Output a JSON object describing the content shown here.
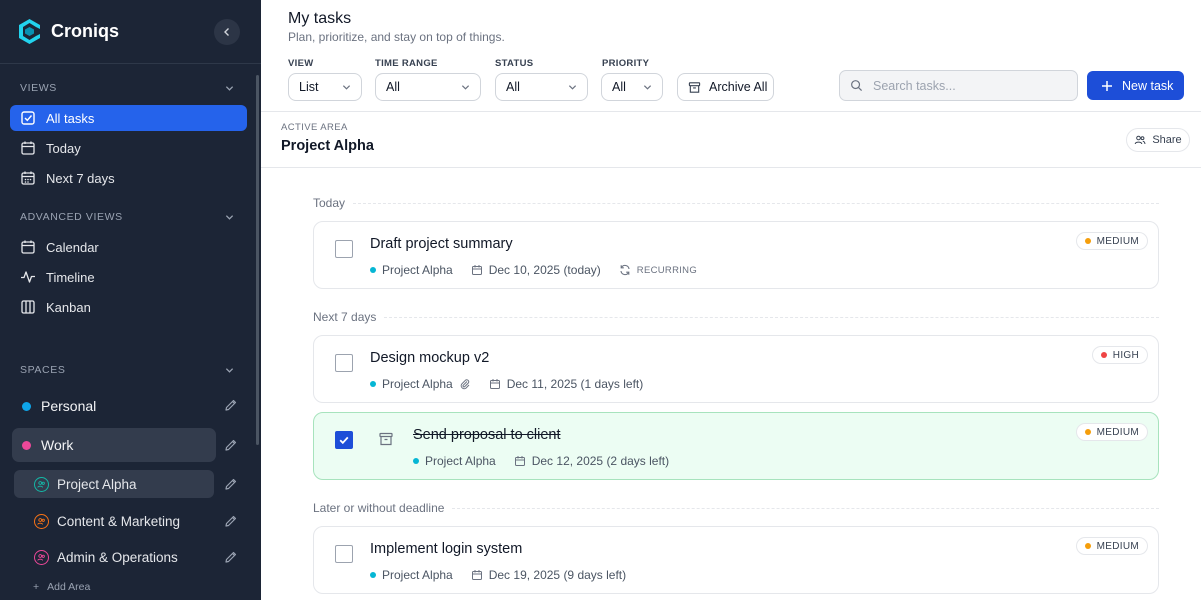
{
  "app": {
    "name": "Croniqs"
  },
  "sidebar": {
    "views_heading": "VIEWS",
    "views": [
      {
        "label": "All tasks",
        "icon": "check-square-icon",
        "active": true
      },
      {
        "label": "Today",
        "icon": "calendar-icon",
        "active": false
      },
      {
        "label": "Next 7 days",
        "icon": "calendar-week-icon",
        "active": false
      }
    ],
    "advanced_heading": "ADVANCED VIEWS",
    "advanced": [
      {
        "label": "Calendar",
        "icon": "calendar-icon"
      },
      {
        "label": "Timeline",
        "icon": "activity-icon"
      },
      {
        "label": "Kanban",
        "icon": "columns-icon"
      }
    ],
    "spaces_heading": "SPACES",
    "spaces": [
      {
        "label": "Personal",
        "color": "#0ea5e9"
      },
      {
        "label": "Work",
        "color": "#ec4899"
      }
    ],
    "areas": [
      {
        "label": "Project Alpha",
        "color": "#14b8a6"
      },
      {
        "label": "Content & Marketing",
        "color": "#f97316"
      },
      {
        "label": "Admin & Operations",
        "color": "#ec4899"
      }
    ],
    "add_area": "Add Area"
  },
  "header": {
    "title": "My tasks",
    "subtitle": "Plan, prioritize, and stay on top of things.",
    "filters": {
      "view_label": "VIEW",
      "view_value": "List",
      "range_label": "TIME RANGE",
      "range_value": "All",
      "status_label": "STATUS",
      "status_value": "All",
      "priority_label": "PRIORITY",
      "priority_value": "All"
    },
    "archive_all": "Archive All",
    "search_placeholder": "Search tasks...",
    "new_task": "New task"
  },
  "area": {
    "label": "ACTIVE AREA",
    "name": "Project Alpha",
    "share": "Share"
  },
  "groups": [
    {
      "heading": "Today"
    },
    {
      "heading": "Next 7 days"
    },
    {
      "heading": "Later or without deadline"
    }
  ],
  "tasks": [
    {
      "title": "Draft project summary",
      "project": "Project Alpha",
      "date": "Dec 10, 2025 (today)",
      "recurring": "RECURRING",
      "priority": "MEDIUM",
      "priority_color": "#f59e0b",
      "done": false
    },
    {
      "title": "Design mockup v2",
      "project": "Project Alpha",
      "date": "Dec 11, 2025 (1 days left)",
      "priority": "HIGH",
      "priority_color": "#ef4444",
      "done": false,
      "attachment": true
    },
    {
      "title": "Send proposal to client",
      "project": "Project Alpha",
      "date": "Dec 12, 2025 (2 days left)",
      "priority": "MEDIUM",
      "priority_color": "#f59e0b",
      "done": true
    },
    {
      "title": "Implement login system",
      "project": "Project Alpha",
      "date": "Dec 19, 2025 (9 days left)",
      "priority": "MEDIUM",
      "priority_color": "#f59e0b",
      "done": false
    }
  ],
  "colors": {
    "sidebar_bg": "#1c2536",
    "accent": "#2563eb",
    "done_bg": "#ecfdf3"
  }
}
